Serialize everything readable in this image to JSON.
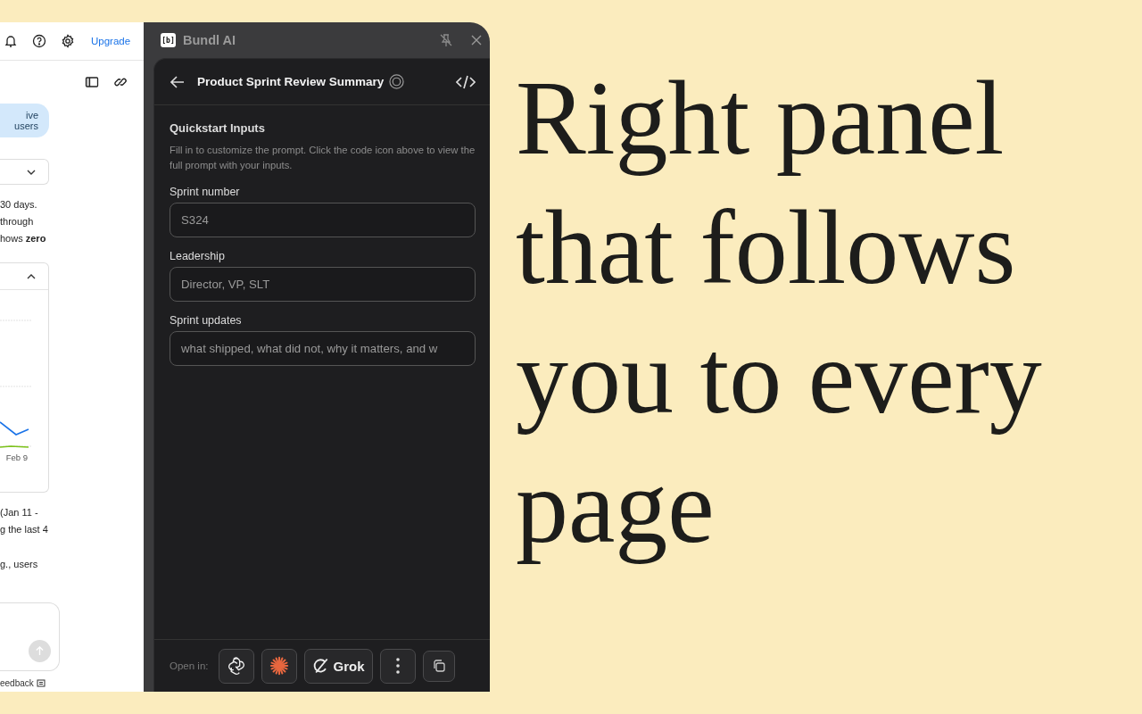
{
  "left_page": {
    "upgrade_link": "Upgrade",
    "chip": "ive users",
    "paragraph_1": [
      "30 days.",
      "through",
      "hows **zero**"
    ],
    "chart_xlabel": "Feb 9",
    "paragraph_2": [
      "(Jan 11 -",
      "g the last 4"
    ],
    "paragraph_3": [
      "g., users"
    ],
    "footer_link": "eedback"
  },
  "panel": {
    "logo": "[b]",
    "app_name": "Bundl AI",
    "title": "Product Sprint Review Summary",
    "section_title": "Quickstart Inputs",
    "hint": "Fill in to customize the prompt. Click the code icon above to view the full prompt with your inputs.",
    "fields": [
      {
        "label": "Sprint number",
        "placeholder": "S324"
      },
      {
        "label": "Leadership",
        "placeholder": "Director, VP, SLT"
      },
      {
        "label": "Sprint updates",
        "placeholder": "what shipped, what did not, why it matters, and w"
      }
    ],
    "open_in_label": "Open in:",
    "open_in_buttons": [
      {
        "kind": "knot"
      },
      {
        "kind": "spark"
      },
      {
        "kind": "grok",
        "label": "Grok"
      },
      {
        "kind": "more"
      }
    ]
  },
  "headline_lines": [
    "Right panel",
    "that follows",
    "you to every",
    "page"
  ]
}
